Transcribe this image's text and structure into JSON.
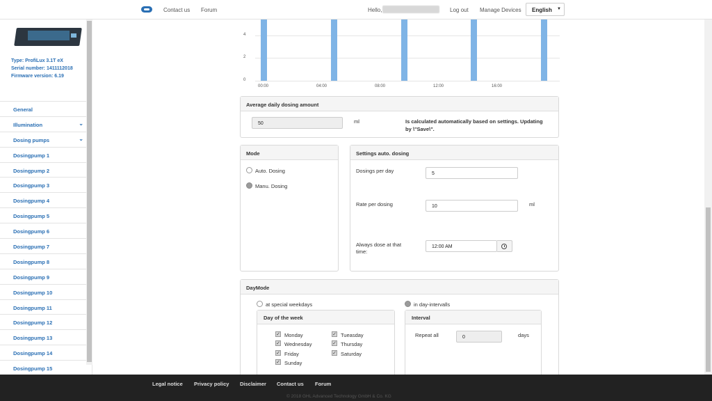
{
  "topbar": {
    "contact": "Contact us",
    "forum": "Forum",
    "hello": "Hello,",
    "logout": "Log out",
    "manage": "Manage Devices",
    "language": "English"
  },
  "device": {
    "type": "Type: ProfiLux 3.1T eX",
    "serial": "Serial number: 1411112018",
    "firmware": "Firmware version: 6.19"
  },
  "sidebar": {
    "items": [
      {
        "label": "General"
      },
      {
        "label": "Illumination",
        "icon": "chevron-down-icon"
      },
      {
        "label": "Dosing pumps",
        "icon": "chevron-down-icon"
      },
      {
        "label": "Dosingpump 1"
      },
      {
        "label": "Dosingpump 2"
      },
      {
        "label": "Dosingpump 3"
      },
      {
        "label": "Dosingpump 4"
      },
      {
        "label": "Dosingpump 5"
      },
      {
        "label": "Dosingpump 6"
      },
      {
        "label": "Dosingpump 7"
      },
      {
        "label": "Dosingpump 8"
      },
      {
        "label": "Dosingpump 9"
      },
      {
        "label": "Dosingpump 10"
      },
      {
        "label": "Dosingpump 11"
      },
      {
        "label": "Dosingpump 12"
      },
      {
        "label": "Dosingpump 13"
      },
      {
        "label": "Dosingpump 14"
      },
      {
        "label": "Dosingpump 15"
      }
    ]
  },
  "chart_data": {
    "type": "bar",
    "x_ticks": [
      "00:00",
      "04:00",
      "08:00",
      "12:00",
      "16:00"
    ],
    "y_ticks": [
      "0",
      "2",
      "4"
    ],
    "bar_color": "#7fb4e6",
    "bars": [
      {
        "x": "00:00",
        "value": 10
      },
      {
        "x": "04:48",
        "value": 10
      },
      {
        "x": "09:36",
        "value": 10
      },
      {
        "x": "14:24",
        "value": 10
      },
      {
        "x": "19:12",
        "value": 10
      }
    ],
    "ylim_visible": [
      0,
      5.5
    ],
    "grid": true
  },
  "avg": {
    "title": "Average daily dosing amount",
    "value": "50",
    "unit": "ml",
    "note": "Is calculated automatically based on settings. Updating by \\\"Save\\\"."
  },
  "mode": {
    "title": "Mode",
    "auto": "Auto. Dosing",
    "manual": "Manu. Dosing",
    "selected": "manual"
  },
  "settings": {
    "title": "Settings auto. dosing",
    "per_day_label": "Dosings per day",
    "per_day_value": "5",
    "rate_label": "Rate per dosing",
    "rate_value": "10",
    "rate_unit": "ml",
    "always_label_1": "Always dose at that",
    "always_label_2": "time:",
    "always_value": "12:00 AM"
  },
  "daymode": {
    "title": "DayMode",
    "opt_weekdays": "at special weekdays",
    "opt_intervals": "in day-intervalls",
    "dow_title": "Day of the week",
    "days": [
      "Monday",
      "Tueasday",
      "Wednesday",
      "Thursday",
      "Friday",
      "Saturday",
      "Sunday"
    ],
    "interval_title": "Interval",
    "repeat_label": "Repeat all",
    "repeat_value": "0",
    "repeat_unit": "days"
  },
  "footer": {
    "legal": "Legal notice",
    "privacy": "Privacy policy",
    "disclaimer": "Disclaimer",
    "contact": "Contact us",
    "forum": "Forum",
    "copyright": "© 2018 GHL Advanced Technology GmbH & Co. KG"
  }
}
